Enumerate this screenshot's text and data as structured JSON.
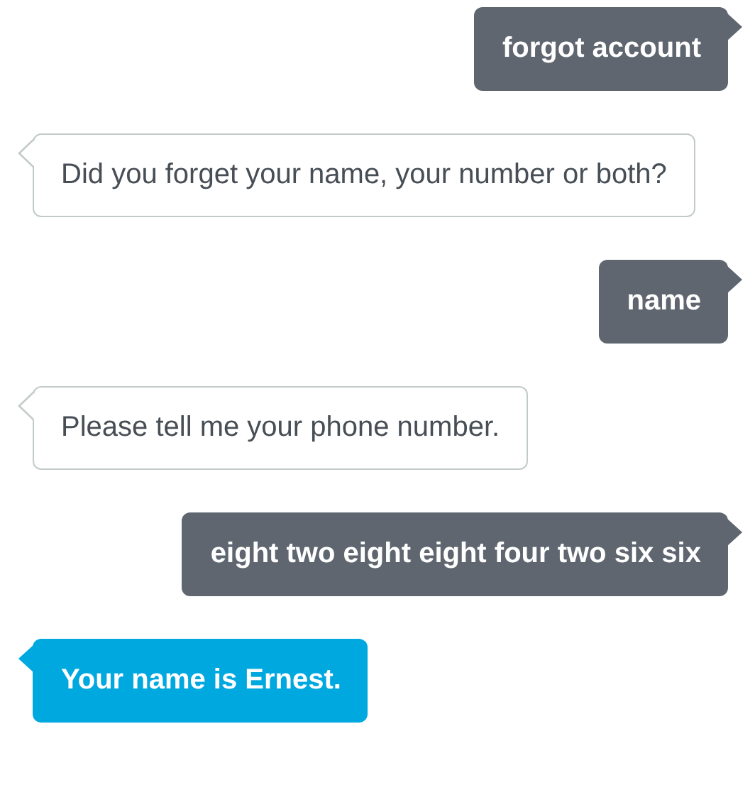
{
  "messages": [
    {
      "kind": "sent",
      "text": "forgot account"
    },
    {
      "kind": "received",
      "text": "Did you forget your name, your number or both?"
    },
    {
      "kind": "sent",
      "text": "name"
    },
    {
      "kind": "received",
      "text": "Please tell me your phone number."
    },
    {
      "kind": "sent",
      "text": "eight two eight eight four two six six"
    },
    {
      "kind": "answer",
      "text": "Your name is Ernest."
    }
  ]
}
